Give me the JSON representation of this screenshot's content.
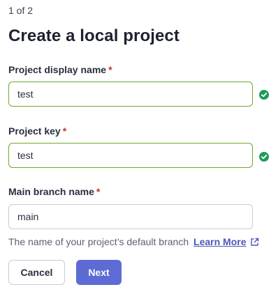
{
  "step_indicator": "1 of 2",
  "title": "Create a local project",
  "fields": {
    "display_name": {
      "label": "Project display name",
      "required_mark": "*",
      "value": "test",
      "status": "valid"
    },
    "project_key": {
      "label": "Project key",
      "required_mark": "*",
      "value": "test",
      "status": "valid"
    },
    "main_branch": {
      "label": "Main branch name",
      "required_mark": "*",
      "value": "main",
      "help_text": "The name of your project’s default branch",
      "learn_more_label": "Learn More",
      "learn_more_icon": "external-link-icon"
    }
  },
  "buttons": {
    "cancel_label": "Cancel",
    "next_label": "Next"
  },
  "colors": {
    "valid_border": "#6ea82e",
    "valid_check": "#1e9b5a",
    "required": "#c4322b",
    "primary": "#5d6cd4",
    "link": "#4c57b8"
  }
}
